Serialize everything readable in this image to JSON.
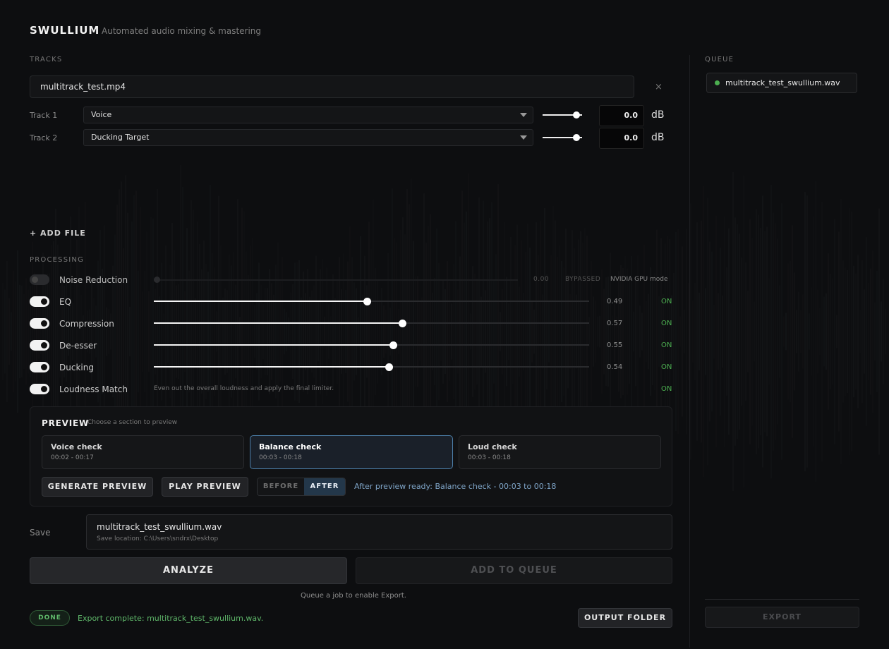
{
  "app": {
    "name": "SWULLIUM",
    "tagline": "Automated audio mixing & mastering"
  },
  "tracks": {
    "section_label": "TRACKS",
    "file_name": "multitrack_test.mp4",
    "remove_glyph": "×",
    "rows": [
      {
        "label": "Track 1",
        "role": "Voice",
        "gain": "0.0",
        "unit": "dB",
        "gain_level": 0.85
      },
      {
        "label": "Track 2",
        "role": "Ducking Target",
        "gain": "0.0",
        "unit": "dB",
        "gain_level": 0.85
      }
    ],
    "add_file_label": "+ ADD FILE"
  },
  "processing": {
    "section_label": "PROCESSING",
    "noise_reduction": {
      "label": "Noise Reduction",
      "value": "0.00",
      "status": "BYPASSED",
      "mode": "NVIDIA GPU mode",
      "enabled": false
    },
    "items": [
      {
        "label": "EQ",
        "value": "0.49",
        "status": "ON"
      },
      {
        "label": "Compression",
        "value": "0.57",
        "status": "ON"
      },
      {
        "label": "De-esser",
        "value": "0.55",
        "status": "ON"
      },
      {
        "label": "Ducking",
        "value": "0.54",
        "status": "ON"
      }
    ],
    "loudness": {
      "label": "Loudness Match",
      "description": "Even out the overall loudness and apply the final limiter.",
      "status": "ON"
    }
  },
  "preview": {
    "title": "PREVIEW",
    "subtitle": "Choose a section to preview",
    "sections": [
      {
        "title": "Voice check",
        "time": "00:02 - 00:17",
        "active": false
      },
      {
        "title": "Balance check",
        "time": "00:03 - 00:18",
        "active": true
      },
      {
        "title": "Loud check",
        "time": "00:03 - 00:18",
        "active": false
      }
    ],
    "generate_label": "GENERATE PREVIEW",
    "play_label": "PLAY PREVIEW",
    "before_label": "BEFORE",
    "after_label": "AFTER",
    "status": "After preview ready: Balance check - 00:03 to 00:18"
  },
  "save": {
    "label": "Save",
    "file_name": "multitrack_test_swullium.wav",
    "location": "Save location: C:\\Users\\sndrx\\Desktop"
  },
  "actions": {
    "analyze_label": "ANALYZE",
    "add_to_queue_label": "ADD TO QUEUE",
    "queue_hint": "Queue a job to enable Export."
  },
  "footer": {
    "badge": "DONE",
    "message": "Export complete: multitrack_test_swullium.wav.",
    "output_folder_label": "OUTPUT FOLDER"
  },
  "queue": {
    "section_label": "QUEUE",
    "items": [
      {
        "name": "multitrack_test_swullium.wav"
      }
    ],
    "export_label": "EXPORT"
  },
  "colors": {
    "accent_green": "#4caf50",
    "accent_blue": "#4c7ea8",
    "background": "#0d0e10"
  }
}
